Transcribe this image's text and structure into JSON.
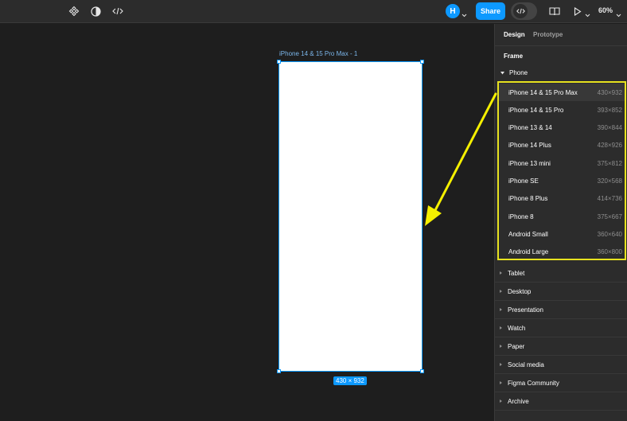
{
  "toolbar": {
    "component_icon": "component-icon",
    "contrast_icon": "contrast-icon",
    "code_icon": "code-icon",
    "avatar_initial": "H",
    "share_label": "Share",
    "zoom_label": "60%"
  },
  "canvas": {
    "frame_label": "iPhone 14 & 15 Pro Max - 1",
    "frame_size": "430 × 932"
  },
  "panel": {
    "tabs": [
      {
        "label": "Design"
      },
      {
        "label": "Prototype"
      }
    ],
    "section_title": "Frame",
    "phone_group": "Phone",
    "devices": [
      {
        "name": "iPhone 14 & 15 Pro Max",
        "size": "430×932"
      },
      {
        "name": "iPhone 14 & 15 Pro",
        "size": "393×852"
      },
      {
        "name": "iPhone 13 & 14",
        "size": "390×844"
      },
      {
        "name": "iPhone 14 Plus",
        "size": "428×926"
      },
      {
        "name": "iPhone 13 mini",
        "size": "375×812"
      },
      {
        "name": "iPhone SE",
        "size": "320×568"
      },
      {
        "name": "iPhone 8 Plus",
        "size": "414×736"
      },
      {
        "name": "iPhone 8",
        "size": "375×667"
      },
      {
        "name": "Android Small",
        "size": "360×640"
      },
      {
        "name": "Android Large",
        "size": "360×800"
      }
    ],
    "categories": [
      {
        "label": "Tablet"
      },
      {
        "label": "Desktop"
      },
      {
        "label": "Presentation"
      },
      {
        "label": "Watch"
      },
      {
        "label": "Paper"
      },
      {
        "label": "Social media"
      },
      {
        "label": "Figma Community"
      },
      {
        "label": "Archive"
      }
    ]
  },
  "colors": {
    "accent": "#0d99ff",
    "highlight": "#e7e21f"
  }
}
